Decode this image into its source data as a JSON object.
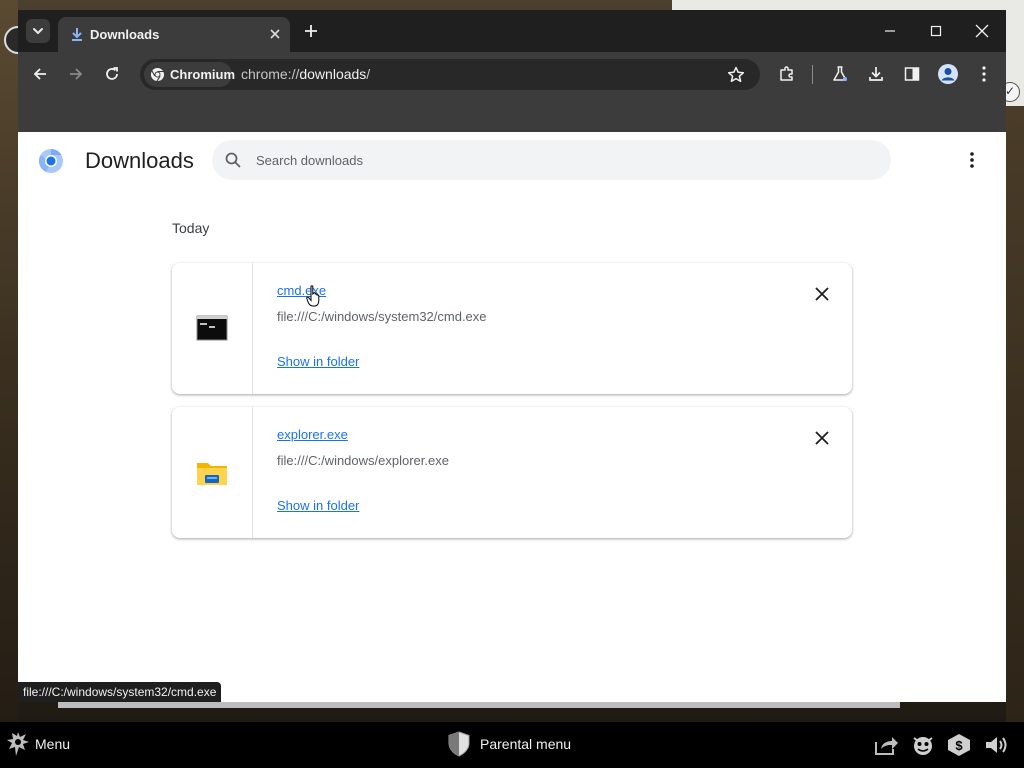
{
  "browser": {
    "tab": {
      "title": "Downloads"
    },
    "omnibox": {
      "chip_label": "Chromium",
      "url_scheme": "chrome://",
      "url_host": "downloads",
      "url_path": "/"
    }
  },
  "page": {
    "title": "Downloads",
    "search": {
      "placeholder": "Search downloads",
      "value": ""
    },
    "section_label": "Today",
    "downloads": [
      {
        "name": "cmd.exe",
        "url": "file:///C:/windows/system32/cmd.exe",
        "action": "Show in folder",
        "icon": "terminal-icon"
      },
      {
        "name": "explorer.exe",
        "url": "file:///C:/windows/explorer.exe",
        "action": "Show in folder",
        "icon": "folder-icon"
      }
    ],
    "status_bubble": "file:///C:/windows/system32/cmd.exe"
  },
  "taskbar": {
    "menu_label": "Menu",
    "parental_label": "Parental menu"
  },
  "colors": {
    "accent": "#1a73e8",
    "titlebar": "#1f1f1f",
    "toolbar": "#3c3c3c"
  }
}
